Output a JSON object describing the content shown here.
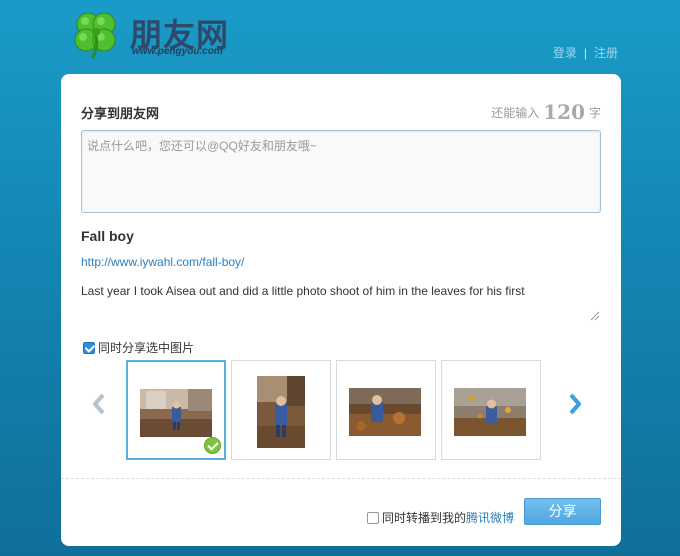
{
  "header": {
    "logo_text": "朋友网",
    "logo_url": "www.pengyou.com",
    "login_label": "登录",
    "separator": "|",
    "register_label": "注册"
  },
  "share_card": {
    "title": "分享到朋友网",
    "counter_prefix": "还能输入",
    "counter_value": "120",
    "counter_suffix": "字",
    "input_placeholder": "说点什么吧，您还可以@QQ好友和朋友哦~",
    "input_value": "",
    "link": {
      "title": "Fall boy",
      "url": "http://www.iywahl.com/fall-boy/",
      "description": "Last year I took Aisea out and did a little photo shoot of him in the leaves for his first"
    },
    "share_images_label": "同时分享选中图片",
    "share_images_checked": true,
    "images": [
      {
        "name": "photo-1",
        "selected": true
      },
      {
        "name": "photo-2",
        "selected": false
      },
      {
        "name": "photo-3",
        "selected": false
      },
      {
        "name": "photo-4",
        "selected": false
      }
    ],
    "repost_label": "同时转播到我的",
    "repost_link": "腾讯微博",
    "repost_checked": false,
    "submit_label": "分享"
  },
  "colors": {
    "background": "#1588b6",
    "accent": "#4ea7e0",
    "link": "#2b7fc1",
    "check_green": "#7cc442"
  },
  "icons": {
    "logo": "clover-icon",
    "prev": "chevron-left-icon",
    "next": "chevron-right-icon",
    "selected": "check-circle-icon"
  }
}
